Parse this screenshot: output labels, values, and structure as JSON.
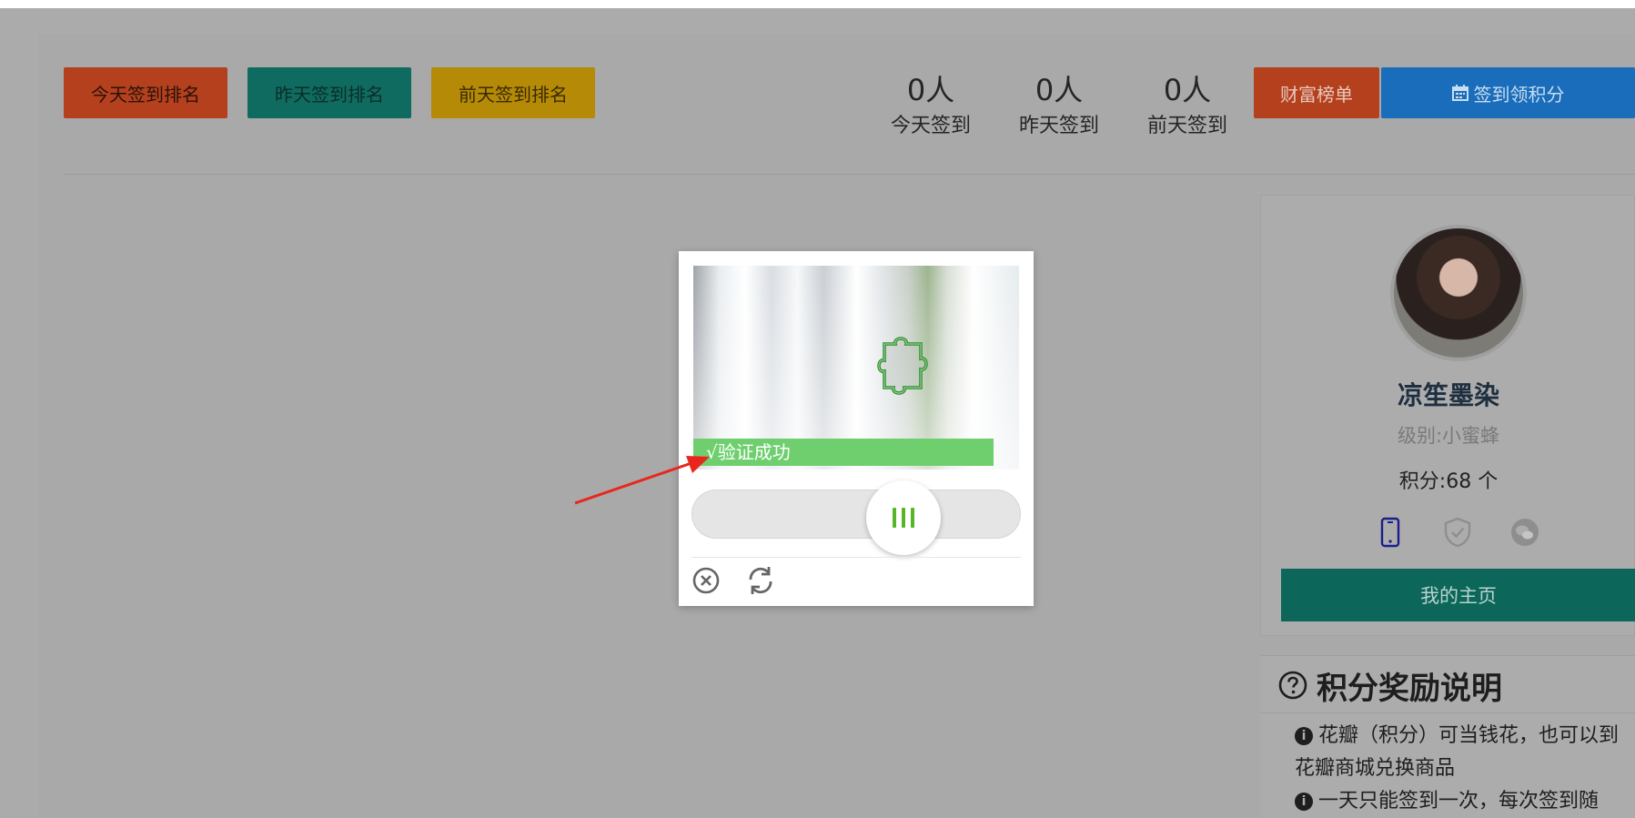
{
  "header": {
    "rank_buttons": [
      "今天签到排名",
      "昨天签到排名",
      "前天签到排名"
    ],
    "stats": [
      {
        "count": "0人",
        "label": "今天签到"
      },
      {
        "count": "0人",
        "label": "昨天签到"
      },
      {
        "count": "0人",
        "label": "前天签到"
      }
    ],
    "wealth_button": "财富榜单",
    "sign_button": "签到领积分",
    "sign_icon": "calendar-icon"
  },
  "captcha": {
    "success_text": "√验证成功",
    "slider_progress": 0.56,
    "close_icon": "close-circle-icon",
    "refresh_icon": "refresh-icon"
  },
  "profile": {
    "name": "凉笙墨染",
    "level": "级别:小蜜蜂",
    "points": "积分:68 个",
    "bind_icons": [
      "phone-icon",
      "shield-icon",
      "wechat-icon"
    ],
    "homepage_button": "我的主页"
  },
  "rules": {
    "title": "积分奖励说明",
    "items": [
      "花瓣（积分）可当钱花，也可以到花瓣商城兑换商品",
      "一天只能签到一次，每次签到随"
    ]
  },
  "colors": {
    "overlay": "#ababab",
    "rank_today": "#b4401e",
    "rank_yesterday": "#0f6b5f",
    "rank_before": "#b48a06",
    "sign_blue": "#1a6dbb",
    "homepage_green": "#0c665a",
    "success_green": "#6fcf6f",
    "slider_knob_bars": "#57b52a",
    "arrow_red": "#e8261c"
  }
}
